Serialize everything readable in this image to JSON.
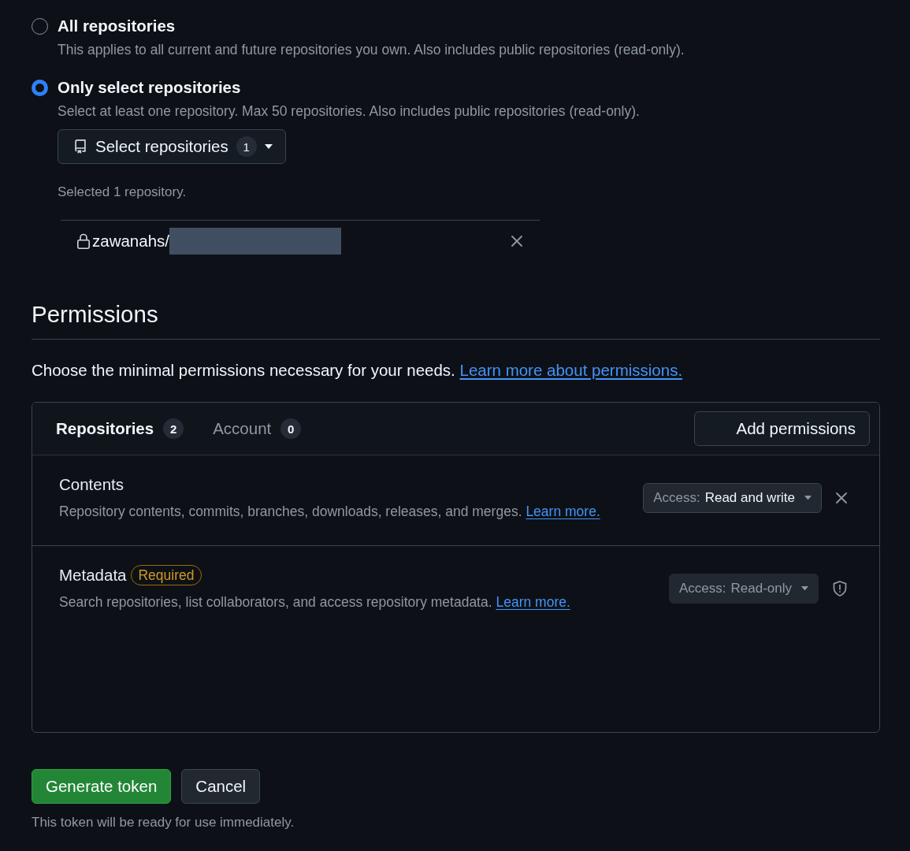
{
  "repository_access": {
    "options": [
      {
        "label": "All repositories",
        "description": "This applies to all current and future repositories you own. Also includes public repositories (read-only).",
        "selected": false
      },
      {
        "label": "Only select repositories",
        "description": "Select at least one repository. Max 50 repositories. Also includes public repositories (read-only).",
        "selected": true
      }
    ],
    "select_button": {
      "label": "Select repositories",
      "count": "1"
    },
    "selected_summary": "Selected 1 repository.",
    "selected_repositories": [
      {
        "name": "zawanahs/",
        "redacted": true
      }
    ]
  },
  "permissions": {
    "title": "Permissions",
    "intro": "Choose the minimal permissions necessary for your needs.",
    "intro_link": "Learn more about permissions.",
    "tabs": [
      {
        "label": "Repositories",
        "count": "2",
        "selected": true
      },
      {
        "label": "Account",
        "count": "0",
        "selected": false
      }
    ],
    "add_button": "Add permissions",
    "items": [
      {
        "name": "Contents",
        "description": "Repository contents, commits, branches, downloads, releases, and merges.",
        "link": "Learn more.",
        "access": {
          "label": "Access:",
          "value": "Read and write",
          "disabled": false
        },
        "required": false
      },
      {
        "name": "Metadata",
        "badge": "Required",
        "description": "Search repositories, list collaborators, and access repository metadata.",
        "link": "Learn more.",
        "access": {
          "label": "Access:",
          "value": "Read-only",
          "disabled": true
        },
        "required": true
      }
    ]
  },
  "actions": {
    "buttons": [
      {
        "label": "Generate token",
        "kind": "primary"
      },
      {
        "label": "Cancel",
        "kind": "secondary"
      }
    ],
    "note": "This token will be ready for use immediately."
  }
}
